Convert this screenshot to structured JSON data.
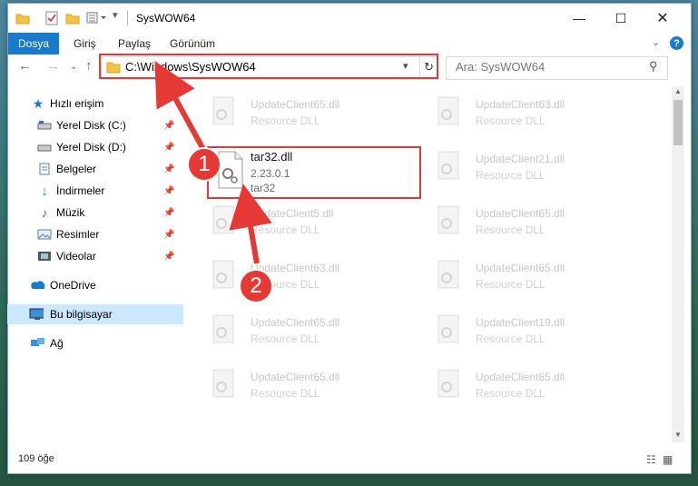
{
  "window": {
    "title": "SysWOW64"
  },
  "ribbon": {
    "tabs": [
      "Dosya",
      "Giriş",
      "Paylaş",
      "Görünüm"
    ]
  },
  "address": {
    "path": "C:\\Windows\\SysWOW64",
    "search_placeholder": "Ara: SysWOW64"
  },
  "nav": {
    "items": [
      {
        "label": "Hızlı erişim",
        "icon": "star-icon"
      },
      {
        "label": "Yerel Disk (C:)",
        "icon": "drive-icon"
      },
      {
        "label": "Yerel Disk (D:)",
        "icon": "drive-icon"
      },
      {
        "label": "Belgeler",
        "icon": "documents-icon"
      },
      {
        "label": "İndirmeler",
        "icon": "download-icon"
      },
      {
        "label": "Müzik",
        "icon": "music-icon"
      },
      {
        "label": "Resimler",
        "icon": "pictures-icon"
      },
      {
        "label": "Videolar",
        "icon": "videos-icon"
      },
      {
        "label": "OneDrive",
        "icon": "cloud-icon"
      },
      {
        "label": "Bu bilgisayar",
        "icon": "computer-icon"
      },
      {
        "label": "Ağ",
        "icon": "network-icon"
      }
    ]
  },
  "files": {
    "highlighted": {
      "name": "tar32.dll",
      "version": "2.23.0.1",
      "description": "tar32"
    },
    "left_col": [
      {
        "name": "UpdateClient65.dll",
        "type": "Resource DLL"
      },
      {
        "name": "UpdateClient5.dll",
        "type": "Resource DLL"
      },
      {
        "name": "UpdateClient63.dll",
        "type": "Resource DLL"
      },
      {
        "name": "UpdateClient65.dll",
        "type": "Resource DLL"
      },
      {
        "name": "UpdateClient65.dll",
        "type": "Resource DLL"
      }
    ],
    "right_col": [
      {
        "name": "UpdateClient63.dll",
        "type": "Resource DLL"
      },
      {
        "name": "UpdateClient21.dll",
        "type": "Resource DLL"
      },
      {
        "name": "UpdateClient65.dll",
        "type": "Resource DLL"
      },
      {
        "name": "UpdateClient65.dll",
        "type": "Resource DLL"
      },
      {
        "name": "UpdateClient19.dll",
        "type": "Resource DLL"
      },
      {
        "name": "UpdateClient65.dll",
        "type": "Resource DLL"
      }
    ]
  },
  "status": {
    "count": "109 öğe"
  },
  "annotations": {
    "badge1": "1",
    "badge2": "2"
  },
  "colors": {
    "accent": "#1979ca",
    "highlight": "#e53935"
  }
}
